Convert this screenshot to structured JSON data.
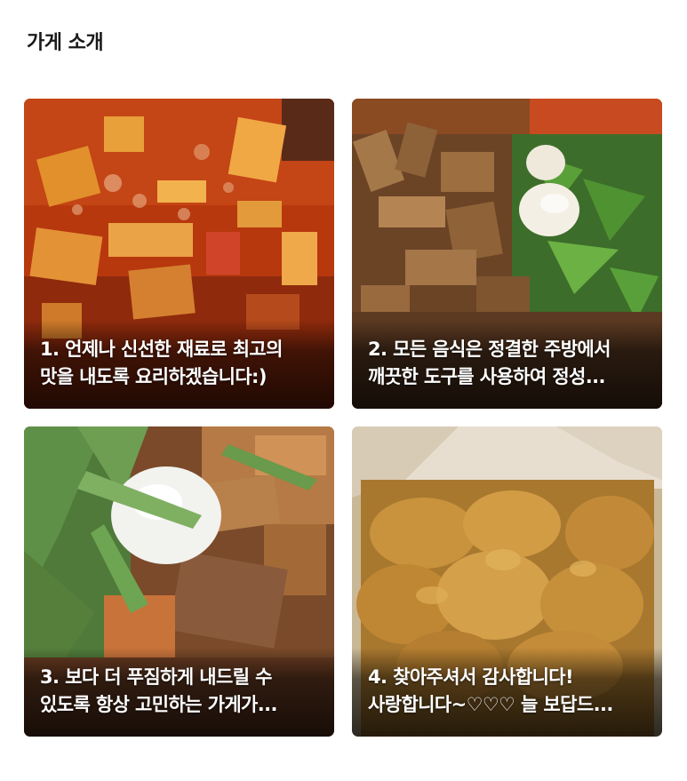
{
  "section": {
    "title": "가게 소개"
  },
  "cards": [
    {
      "line1": "1. 언제나 신선한 재료로 최고의",
      "line2": "맛을 내도록 요리하겠습니다:)",
      "image": "tteokbokki-photo"
    },
    {
      "line1": "2. 모든 음식은 정결한 주방에서",
      "line2": "깨끗한 도구를 사용하여 정성...",
      "image": "rabokki-with-egg-photo"
    },
    {
      "line1": "3. 보다 더 푸짐하게 내드릴 수",
      "line2": "있도록 항상 고민하는 가게가...",
      "image": "closeup-egg-perilla-photo"
    },
    {
      "line1": "4. 찾아주셔서 감사합니다!",
      "line2": "사랑합니다~♡♡♡ 늘 보답드...",
      "image": "fried-chicken-photo"
    }
  ]
}
